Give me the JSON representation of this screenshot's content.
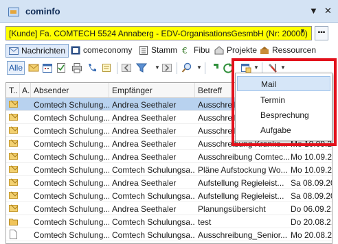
{
  "window": {
    "title": "cominfo",
    "dropdown_glyph": "▼",
    "close_glyph": "✕"
  },
  "company": {
    "value": "[Kunde] Fa. COMTECH 5524 Annaberg - EDV-OrganisationsGesmbH (Nr: 20000)",
    "arrow": "▼",
    "more": "▪▪▪",
    "highlight_color": "#ffff00"
  },
  "modules": [
    {
      "label": "Nachrichten",
      "icon": "messages-icon",
      "active": true
    },
    {
      "label": "comeconomy",
      "icon": "comeconomy-icon"
    },
    {
      "label": "Stamm",
      "icon": "master-data-icon"
    },
    {
      "label": "Fibu",
      "icon": "finance-icon"
    },
    {
      "label": "Projekte",
      "icon": "projects-icon"
    },
    {
      "label": "Ressourcen",
      "icon": "resources-icon"
    }
  ],
  "toolbar": {
    "all_label": "Alle",
    "drop": "▼",
    "icons": [
      "mail-icon",
      "calendar-icon",
      "task-icon",
      "print-icon",
      "phone-icon",
      "note-icon",
      "back-icon",
      "filter-icon",
      "forward-icon",
      "search-icon",
      "export-icon",
      "refresh-icon",
      "new-item-icon",
      "tools-icon"
    ]
  },
  "grid": {
    "columns": [
      "T..",
      "A..",
      "Absender",
      "Empfänger",
      "Betreff"
    ],
    "rows": [
      {
        "type": "mail",
        "sender": "Comtech Schulung...",
        "recipient": "Andrea Seethaler",
        "subject": "Ausschreib",
        "date": "",
        "selected": true
      },
      {
        "type": "mail",
        "sender": "Comtech Schulung...",
        "recipient": "Andrea Seethaler",
        "subject": "Ausschreib",
        "date": ""
      },
      {
        "type": "mail",
        "sender": "Comtech Schulung...",
        "recipient": "Andrea Seethaler",
        "subject": "Ausschreib",
        "date": ""
      },
      {
        "type": "mail",
        "sender": "Comtech Schulung...",
        "recipient": "Andrea Seethaler",
        "subject": "Ausschreibung Kranke...",
        "date": "Mo 10.09.2..."
      },
      {
        "type": "mail",
        "sender": "Comtech Schulung...",
        "recipient": "Andrea Seethaler",
        "subject": "Ausschreibung Comtec...",
        "date": "Mo 10.09.2..."
      },
      {
        "type": "mail",
        "sender": "Comtech Schulung...",
        "recipient": "Comtech Schulungsa...",
        "subject": "Pläne Aufstockung Wo...",
        "date": "Mo 10.09.2..."
      },
      {
        "type": "mail",
        "sender": "Comtech Schulung...",
        "recipient": "Andrea Seethaler",
        "subject": "Aufstellung Regieleist...",
        "date": "Sa 08.09.20..."
      },
      {
        "type": "mail",
        "sender": "Comtech Schulung...",
        "recipient": "Comtech Schulungsa...",
        "subject": "Aufstellung Regieleist...",
        "date": "Sa 08.09.20..."
      },
      {
        "type": "mail",
        "attachment": true,
        "sender": "Comtech Schulung...",
        "recipient": "Andrea Seethaler",
        "subject": "Planungsübersicht",
        "date": "Do 06.09.2..."
      },
      {
        "type": "folder",
        "sender": "Comtech Schulung...",
        "recipient": "Comtech Schulungsa...",
        "subject": "test",
        "date": "Do 20.08.2..."
      },
      {
        "type": "doc",
        "sender": "Comtech Schulung...",
        "recipient": "Comtech Schulungsa...",
        "subject": "Ausschreibung_Senior...",
        "date": "Mo 20.08.2..."
      }
    ]
  },
  "new_menu": {
    "items": [
      {
        "label": "Mail",
        "hover": true
      },
      {
        "label": "Termin"
      },
      {
        "label": "Besprechung"
      },
      {
        "label": "Aufgabe"
      }
    ],
    "highlight_color": "#e2111b"
  }
}
